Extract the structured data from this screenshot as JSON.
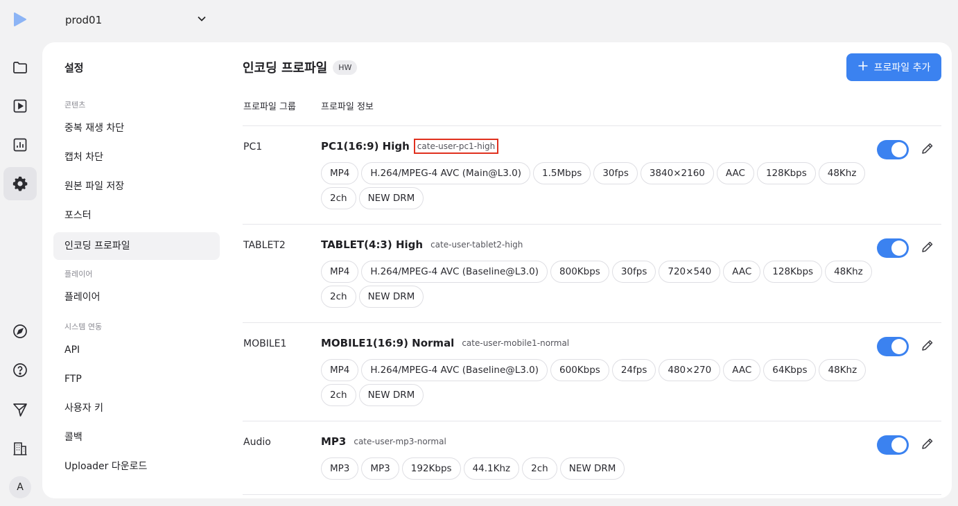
{
  "project": {
    "name": "prod01"
  },
  "rail": {
    "avatar_initial": "A",
    "icons": [
      "folder-icon",
      "video-icon",
      "chart-icon",
      "gear-icon",
      "compass-icon",
      "help-icon",
      "send-icon",
      "building-icon"
    ]
  },
  "settings_nav": {
    "title": "설정",
    "sections": [
      {
        "label": "콘텐츠",
        "items": [
          "중복 재생 차단",
          "캡처 차단",
          "원본 파일 저장",
          "포스터",
          "인코딩 프로파일"
        ]
      },
      {
        "label": "플레이어",
        "items": [
          "플레이어"
        ]
      },
      {
        "label": "시스템 연동",
        "items": [
          "API",
          "FTP",
          "사용자 키",
          "콜백",
          "Uploader 다운로드"
        ]
      }
    ],
    "active_item": "인코딩 프로파일"
  },
  "page": {
    "title": "인코딩 프로파일",
    "badge": "HW",
    "add_button": "프로파일 추가",
    "col_group": "프로파일 그룹",
    "col_info": "프로파일 정보"
  },
  "profiles": [
    {
      "group": "PC1",
      "name": "PC1(16:9) High",
      "code": "cate-user-pc1-high",
      "enabled": true,
      "chips": [
        "MP4",
        "H.264/MPEG-4 AVC (Main@L3.0)",
        "1.5Mbps",
        "30fps",
        "3840×2160",
        "AAC",
        "128Kbps",
        "48Khz",
        "2ch",
        "NEW DRM"
      ]
    },
    {
      "group": "TABLET2",
      "name": "TABLET(4:3) High",
      "code": "cate-user-tablet2-high",
      "enabled": true,
      "chips": [
        "MP4",
        "H.264/MPEG-4 AVC (Baseline@L3.0)",
        "800Kbps",
        "30fps",
        "720×540",
        "AAC",
        "128Kbps",
        "48Khz",
        "2ch",
        "NEW DRM"
      ]
    },
    {
      "group": "MOBILE1",
      "name": "MOBILE1(16:9) Normal",
      "code": "cate-user-mobile1-normal",
      "enabled": true,
      "chips": [
        "MP4",
        "H.264/MPEG-4 AVC (Baseline@L3.0)",
        "600Kbps",
        "24fps",
        "480×270",
        "AAC",
        "64Kbps",
        "48Khz",
        "2ch",
        "NEW DRM"
      ]
    },
    {
      "group": "Audio",
      "name": "MP3",
      "code": "cate-user-mp3-normal",
      "enabled": true,
      "chips": [
        "MP3",
        "MP3",
        "192Kbps",
        "44.1Khz",
        "2ch",
        "NEW DRM"
      ]
    }
  ],
  "colors": {
    "accent": "#3b82f0",
    "highlight_box": "#e0301e"
  }
}
